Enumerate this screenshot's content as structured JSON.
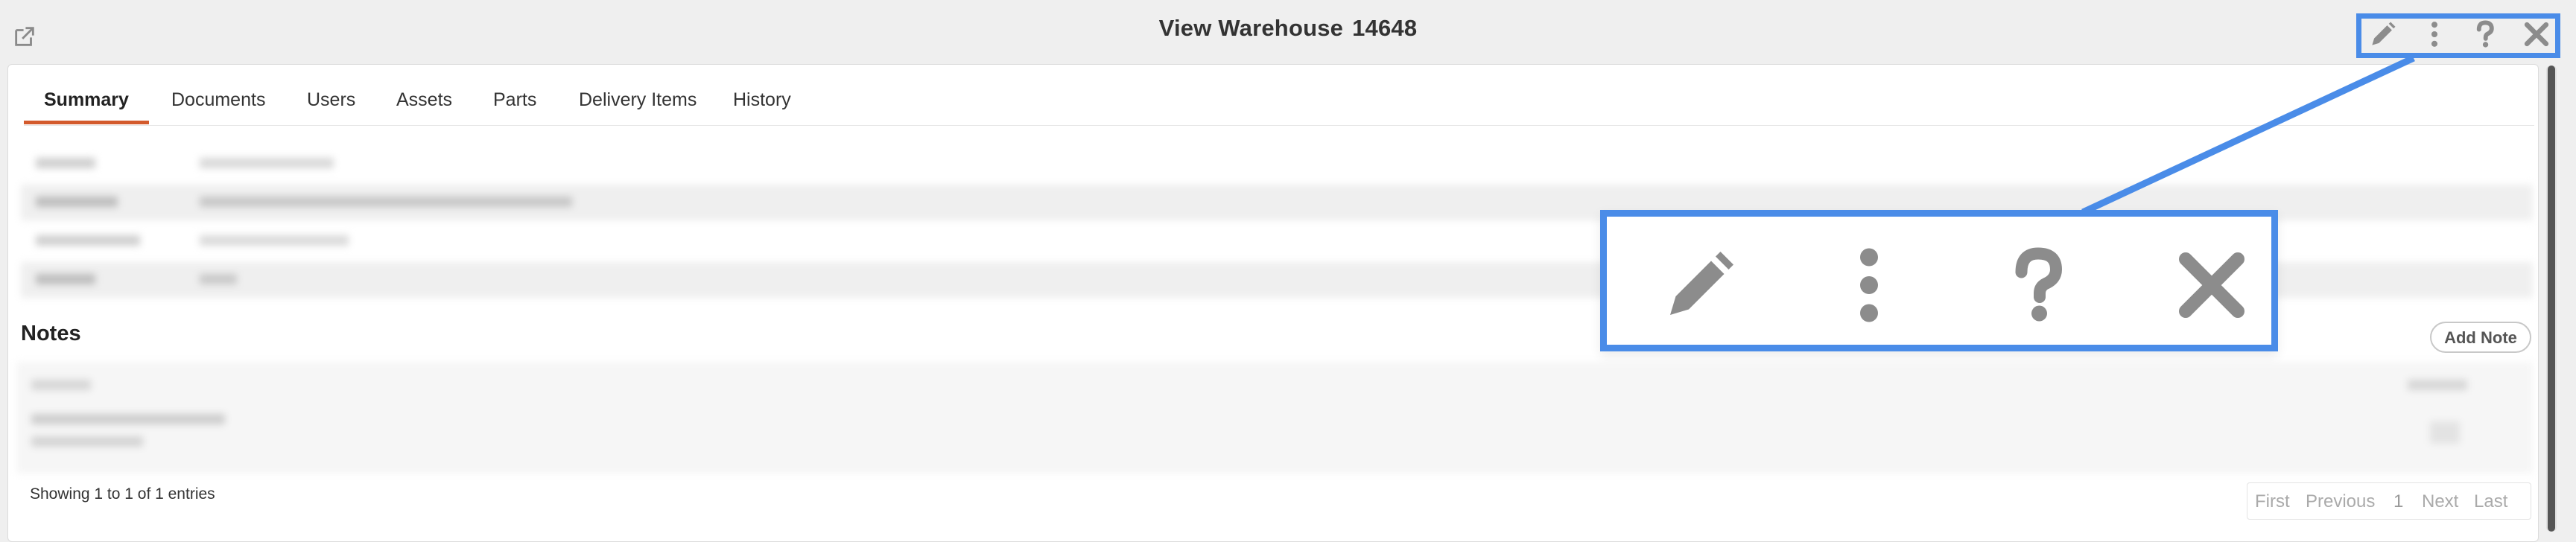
{
  "header": {
    "title": "View Warehouse",
    "record_number": "14648",
    "icons": [
      "external-link-icon",
      "pencil-icon",
      "more-vertical-icon",
      "help-icon",
      "close-icon"
    ]
  },
  "tabs": [
    {
      "label": "Summary",
      "active": true
    },
    {
      "label": "Documents",
      "active": false
    },
    {
      "label": "Users",
      "active": false
    },
    {
      "label": "Assets",
      "active": false
    },
    {
      "label": "Parts",
      "active": false
    },
    {
      "label": "Delivery Items",
      "active": false
    },
    {
      "label": "History",
      "active": false
    }
  ],
  "notes": {
    "title": "Notes",
    "add_label": "Add Note",
    "showing": "Showing 1 to 1 of 1 entries"
  },
  "pagination": {
    "first": "First",
    "previous": "Previous",
    "page": "1",
    "next": "Next",
    "last": "Last"
  },
  "colors": {
    "accent": "#d35a2c",
    "highlight": "#4a8ce8",
    "icon_gray": "#8c8c8c"
  }
}
